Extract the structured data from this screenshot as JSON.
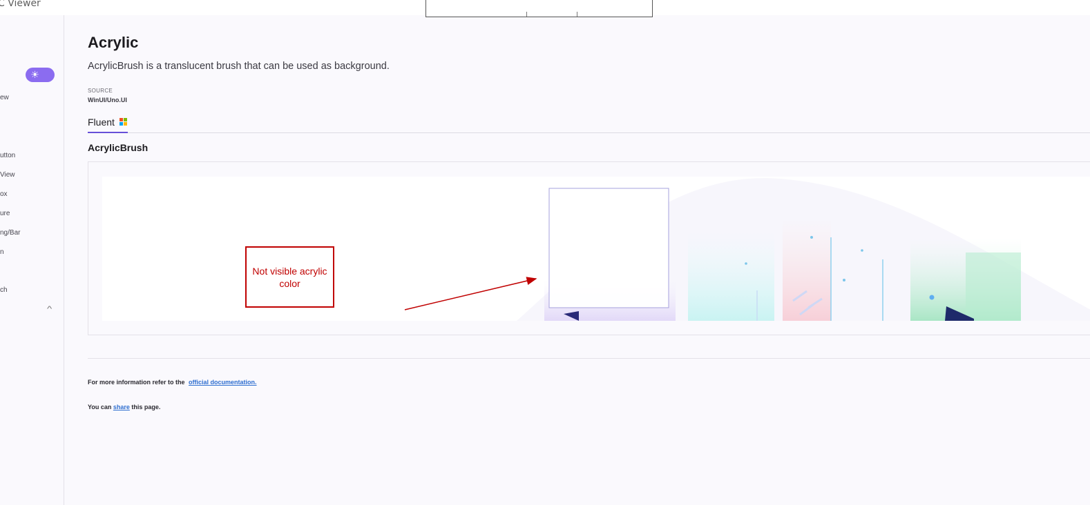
{
  "window": {
    "title": "C Viewer"
  },
  "sidebar": {
    "items": [
      {
        "label": "ew"
      },
      {
        "label": "utton"
      },
      {
        "label": "View"
      },
      {
        "label": "ox"
      },
      {
        "label": "ure"
      },
      {
        "label": "ng/Bar"
      },
      {
        "label": "n"
      },
      {
        "label": "ch"
      }
    ]
  },
  "page": {
    "title": "Acrylic",
    "description": "AcrylicBrush is a translucent brush that can be used as background.",
    "source_label": "SOURCE",
    "source_value": "WinUI/Uno.UI",
    "tabs": [
      {
        "label": "Fluent"
      }
    ],
    "section_title": "AcrylicBrush"
  },
  "annotation": {
    "text": "Not visible acrylic color"
  },
  "footer": {
    "info_prefix": "For more information refer to the",
    "info_link": "official documentation.",
    "share_prefix": "You can",
    "share_link": "share",
    "share_suffix": "this page."
  },
  "colors": {
    "accent": "#6750d8",
    "toggle": "#8b6cf0",
    "annotation": "#c00000",
    "link": "#2f6fd0",
    "ms_red": "#f25022",
    "ms_green": "#7fba00",
    "ms_blue": "#00a4ef",
    "ms_yellow": "#ffb900"
  }
}
